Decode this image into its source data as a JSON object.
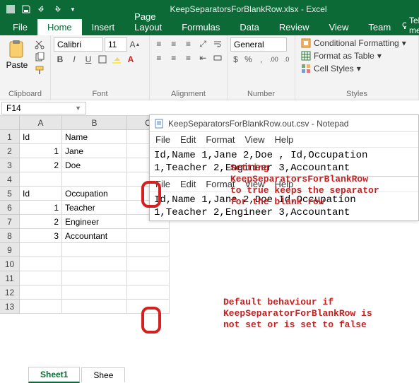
{
  "titlebar": {
    "title": "KeepSeparatorsForBlankRow.xlsx - Excel"
  },
  "tabs": {
    "file": "File",
    "home": "Home",
    "insert": "Insert",
    "pagelayout": "Page Layout",
    "formulas": "Formulas",
    "data": "Data",
    "review": "Review",
    "view": "View",
    "team": "Team",
    "tellme": "Tell me..."
  },
  "ribbon": {
    "clipboard": {
      "paste": "Paste",
      "label": "Clipboard"
    },
    "font": {
      "name": "Calibri",
      "size": "11",
      "label": "Font"
    },
    "alignment": {
      "label": "Alignment"
    },
    "number": {
      "format": "General",
      "label": "Number"
    },
    "styles": {
      "cond": "Conditional Formatting",
      "table": "Format as Table",
      "cell": "Cell Styles",
      "label": "Styles"
    }
  },
  "namebox": "F14",
  "grid": {
    "cols": [
      "A",
      "B",
      "C"
    ],
    "rows": [
      {
        "n": 1,
        "A": "Id",
        "B": "Name"
      },
      {
        "n": 2,
        "A": "1",
        "B": "Jane",
        "Ar": true
      },
      {
        "n": 3,
        "A": "2",
        "B": "Doe",
        "Ar": true
      },
      {
        "n": 4
      },
      {
        "n": 5,
        "A": "Id",
        "B": "Occupation"
      },
      {
        "n": 6,
        "A": "1",
        "B": "Teacher",
        "Ar": true
      },
      {
        "n": 7,
        "A": "2",
        "B": "Engineer",
        "Ar": true
      },
      {
        "n": 8,
        "A": "3",
        "B": "Accountant",
        "Ar": true
      },
      {
        "n": 9
      },
      {
        "n": 10
      },
      {
        "n": 11
      },
      {
        "n": 12
      },
      {
        "n": 13
      }
    ]
  },
  "notepad": {
    "title": "KeepSeparatorsForBlankRow.out.csv - Notepad",
    "menu": [
      "File",
      "Edit",
      "Format",
      "View",
      "Help"
    ],
    "block1": [
      "Id,Name",
      "1,Jane",
      "2,Doe",
      ",",
      "Id,Occupation",
      "1,Teacher",
      "2,Engineer",
      "3,Accountant"
    ],
    "block2": [
      "Id,Name",
      "1,Jane",
      "2,Doe",
      "",
      "Id,Occupation",
      "1,Teacher",
      "2,Engineer",
      "3,Accountant"
    ]
  },
  "ann1": "Setting\nKeepSeparatorsForBlankRow\nto true keeps the separator\nfor the blank row",
  "ann2": "Default behaviour if\nKeepSeparatorForBlankRow is\nnot set or is set to false",
  "sheets": {
    "s1": "Sheet1",
    "s2": "Shee"
  }
}
